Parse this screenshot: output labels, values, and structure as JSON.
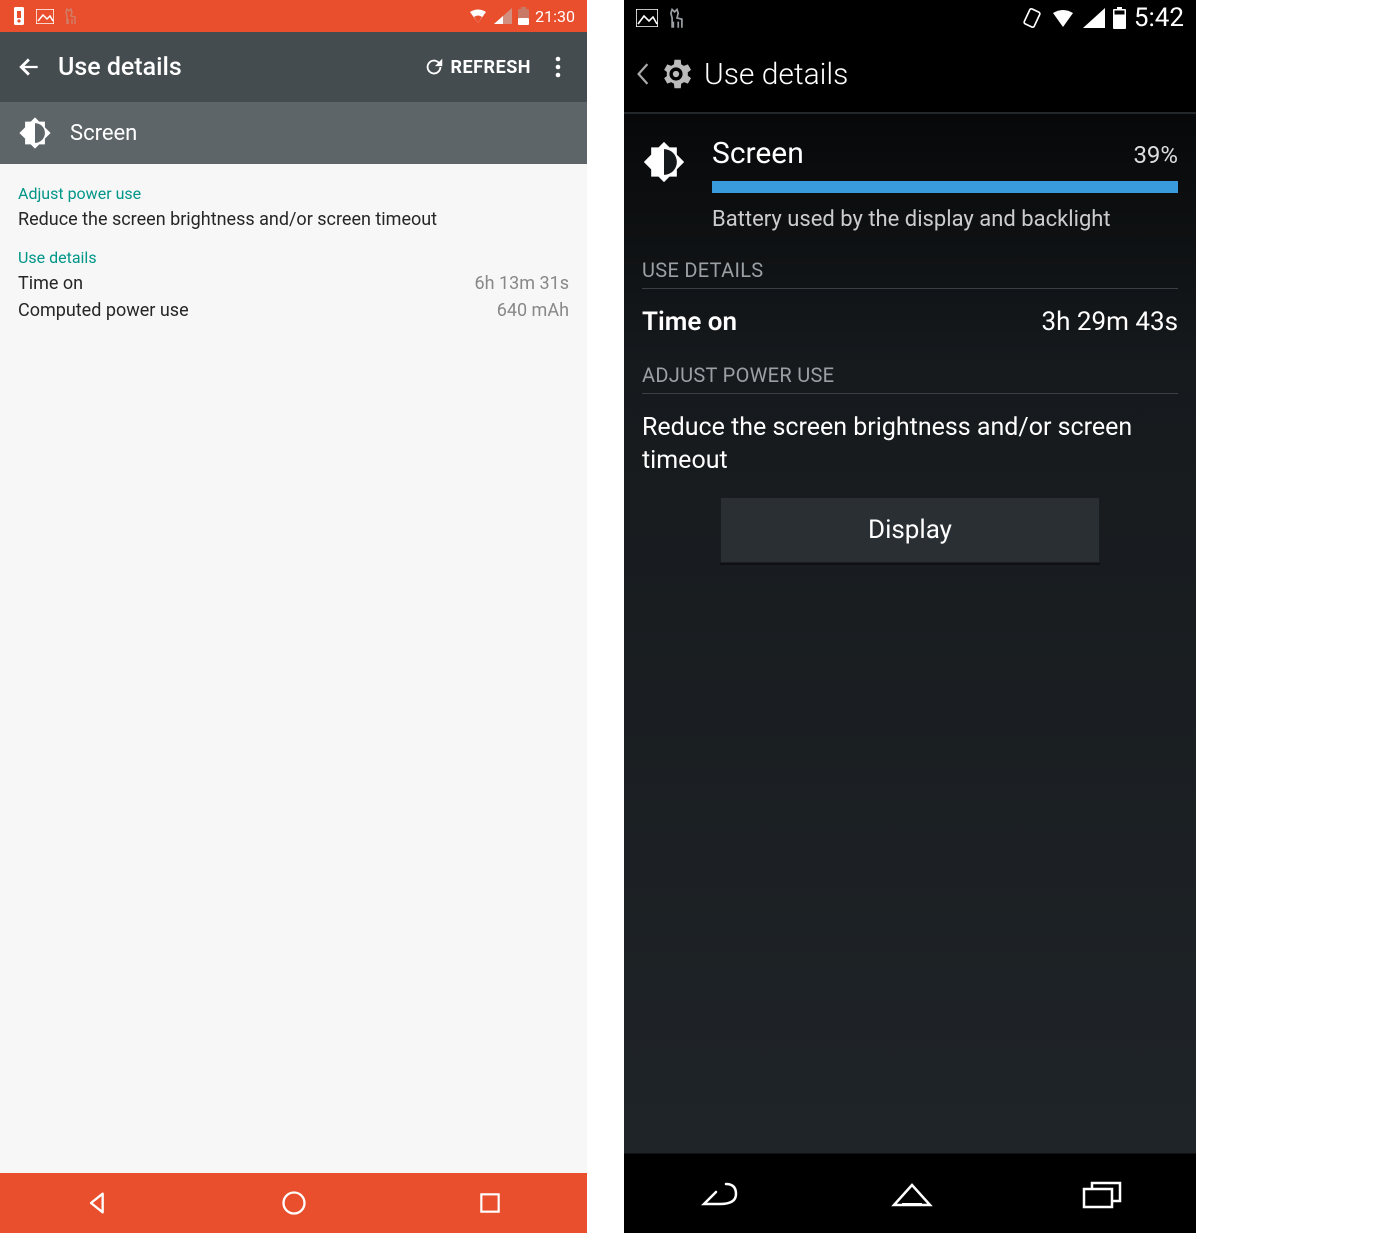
{
  "left": {
    "statusbar": {
      "time": "21:30"
    },
    "appbar": {
      "title": "Use details",
      "refresh": "REFRESH"
    },
    "subheader": {
      "title": "Screen"
    },
    "sections": {
      "adjust_title": "Adjust power use",
      "adjust_body": "Reduce the screen brightness and/or screen timeout",
      "details_title": "Use details",
      "rows": [
        {
          "label": "Time on",
          "value": "6h 13m 31s"
        },
        {
          "label": "Computed power use",
          "value": "640 mAh"
        }
      ]
    }
  },
  "right": {
    "statusbar": {
      "time": "5:42"
    },
    "appbar": {
      "title": "Use details"
    },
    "top": {
      "title": "Screen",
      "percent_label": "39%",
      "percent_value": 39,
      "desc": "Battery used by the display and backlight"
    },
    "sections": {
      "details_title": "USE DETAILS",
      "row": {
        "label": "Time on",
        "value": "3h 29m 43s"
      },
      "adjust_title": "ADJUST POWER USE",
      "adjust_body": "Reduce the screen brightness and/or screen timeout",
      "button": "Display"
    }
  }
}
